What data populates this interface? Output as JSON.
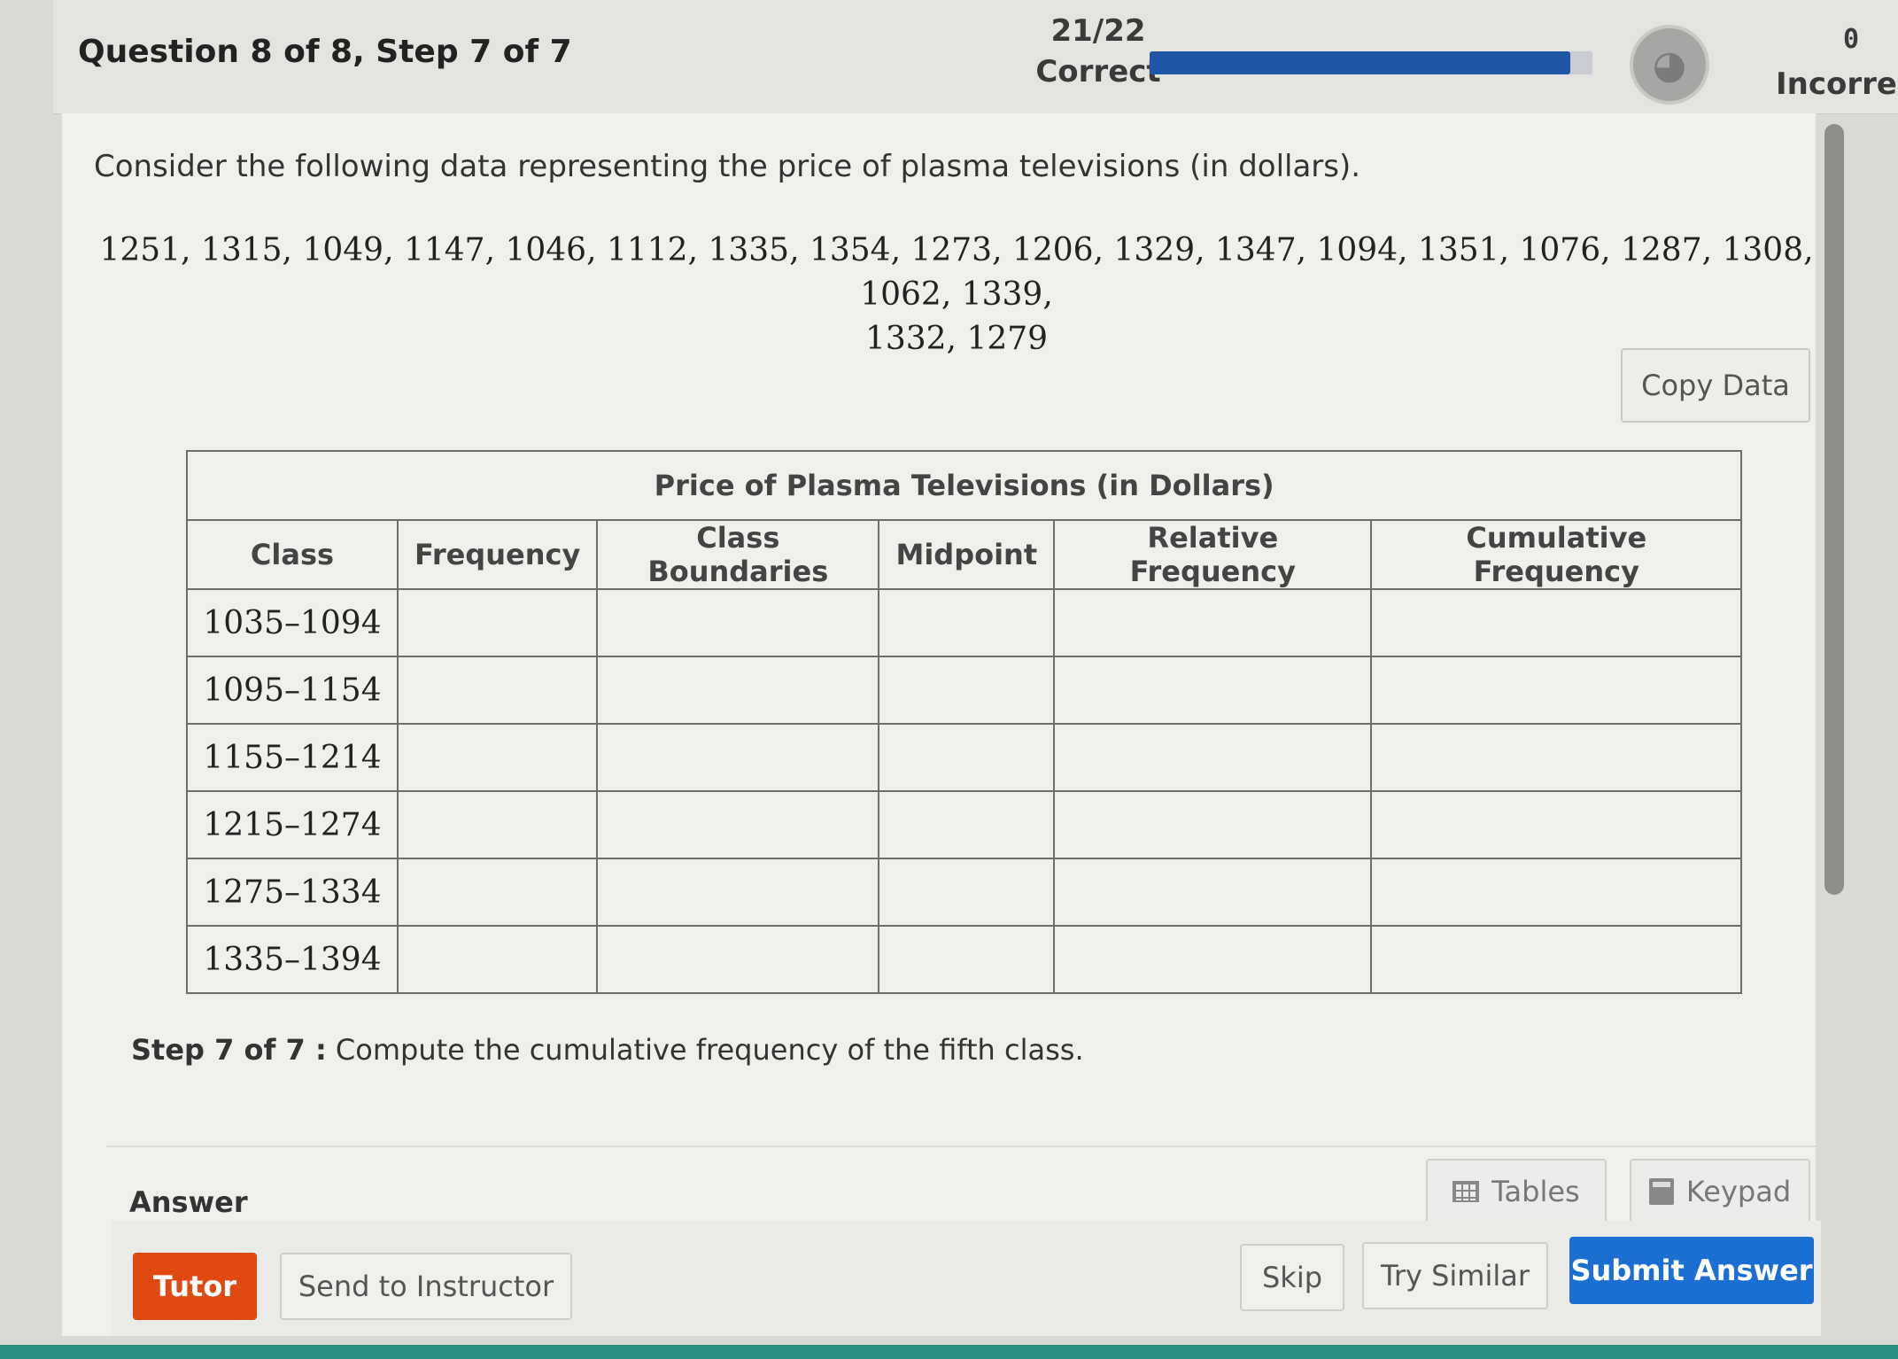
{
  "header": {
    "question_title": "Question 8 of 8,  Step 7 of 7",
    "score_fraction": "21/22",
    "score_label": "Correct",
    "progress_fraction": 0.95,
    "incorrect_count": "0",
    "incorrect_label": "Incorrect"
  },
  "problem": {
    "intro": "Consider the following data representing the price of plasma televisions (in dollars).",
    "data_line1": "1251, 1315, 1049, 1147, 1046, 1112, 1335, 1354, 1273, 1206, 1329, 1347, 1094, 1351, 1076, 1287, 1308, 1062, 1339,",
    "data_line2": "1332, 1279",
    "copy_button": "Copy Data"
  },
  "table": {
    "title": "Price of Plasma Televisions (in Dollars)",
    "headers": [
      "Class",
      "Frequency",
      "Class Boundaries",
      "Midpoint",
      "Relative Frequency",
      "Cumulative Frequency"
    ],
    "rows": [
      "1035–1094",
      "1095–1154",
      "1155–1214",
      "1215–1274",
      "1275–1334",
      "1335–1394"
    ]
  },
  "step": {
    "label": "Step 7 of 7 :",
    "text": "Compute the cumulative frequency of the fifth class."
  },
  "answer": {
    "label": "Answer",
    "tables_button": "Tables",
    "keypad_button": "Keypad"
  },
  "actions": {
    "tutor": "Tutor",
    "send_to_instructor": "Send to Instructor",
    "skip": "Skip",
    "try_similar": "Try Similar",
    "submit": "Submit Answer"
  },
  "colors": {
    "progress": "#1f56a5",
    "tutor": "#e04a12",
    "submit": "#1b6fd3"
  }
}
